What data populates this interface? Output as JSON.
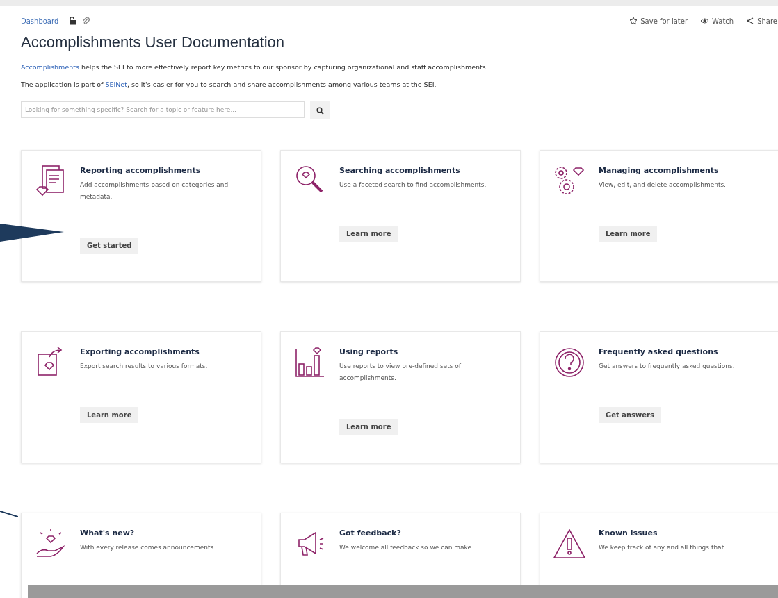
{
  "breadcrumb": "Dashboard",
  "page_actions": [
    {
      "kind": "star",
      "label": "Save for later"
    },
    {
      "kind": "eye",
      "label": "Watch"
    },
    {
      "kind": "share",
      "label": "Share"
    }
  ],
  "title": "Accomplishments User Documentation",
  "paragraphs": [
    {
      "link": "Accomplishments",
      "after": " helps the SEI to more effectively report key metrics to our sponsor by capturing organizational and staff accomplishments."
    },
    {
      "before": "The application is part of ",
      "link": "SEINet",
      "after": ", so it's easier for you to search and share accomplishments among various teams at the SEI."
    }
  ],
  "search": {
    "placeholder": "Looking for something specific? Search for a topic or feature here..."
  },
  "cards": [
    {
      "kind": "report",
      "title": "Reporting accomplishments",
      "description": "Add accomplishments based on categories and metadata.",
      "button": "Get started"
    },
    {
      "kind": "search",
      "title": "Searching accomplishments",
      "description": "Use a faceted search to find accomplishments.",
      "button": "Learn more"
    },
    {
      "kind": "manage",
      "title": "Managing accomplishments",
      "description": "View, edit, and delete accomplishments.",
      "button": "Learn more"
    },
    {
      "kind": "export",
      "title": "Exporting accomplishments",
      "description": "Export search results to various formats.",
      "button": "Learn more"
    },
    {
      "kind": "chart",
      "title": "Using reports",
      "description": "Use reports to view pre-defined sets of accomplishments.",
      "button": "Learn more"
    },
    {
      "kind": "question",
      "title": "Frequently asked questions",
      "description": "Get answers to frequently asked questions.",
      "button": "Get answers"
    },
    {
      "kind": "new",
      "title": "What's new?",
      "description": "With every release comes announcements"
    },
    {
      "kind": "feedback",
      "title": "Got feedback?",
      "description": "We welcome all feedback so we can make"
    },
    {
      "kind": "warning",
      "title": "Known issues",
      "description": "We keep track of any and all things that"
    }
  ]
}
